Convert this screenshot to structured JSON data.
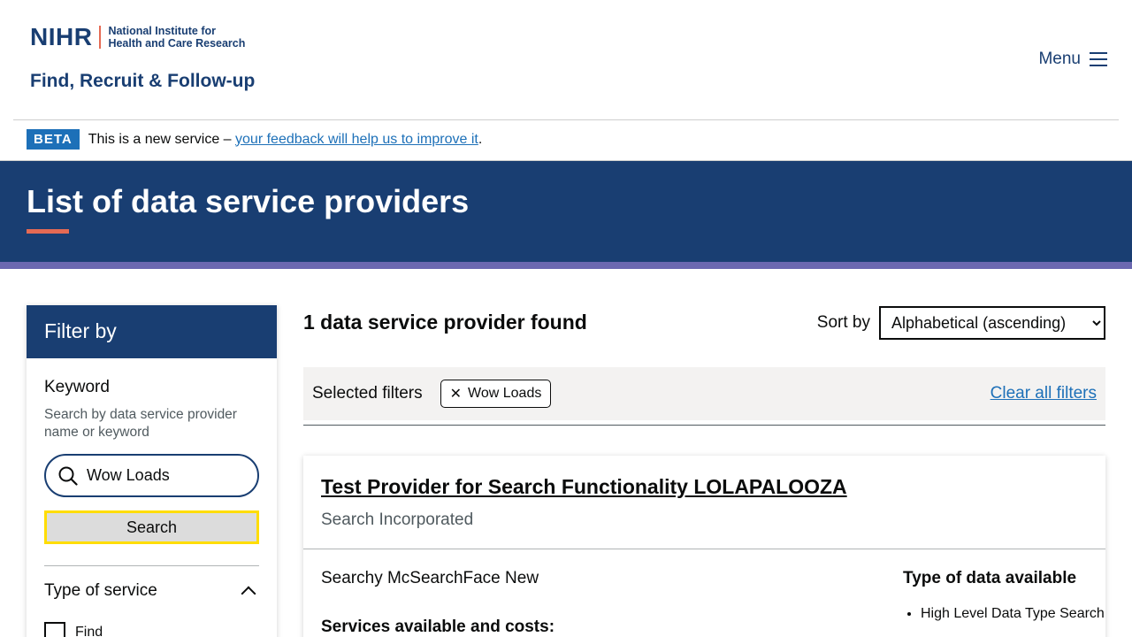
{
  "header": {
    "logo_abbrev": "NIHR",
    "logo_line1": "National Institute for",
    "logo_line2": "Health and Care Research",
    "service_name": "Find, Recruit & Follow-up",
    "menu_label": "Menu"
  },
  "beta": {
    "tag": "BETA",
    "text": "This is a new service –",
    "link": "your feedback will help us to improve it",
    "suffix": "."
  },
  "hero": {
    "title": "List of data service providers"
  },
  "filter": {
    "heading": "Filter by",
    "keyword_label": "Keyword",
    "keyword_hint": "Search by data service provider name or keyword",
    "keyword_value": "Wow Loads",
    "search_button": "Search",
    "type_of_service_label": "Type of service",
    "options": [
      {
        "label": "Find",
        "checked": false
      }
    ]
  },
  "results": {
    "count_text": "1 data service provider found",
    "sort_label": "Sort by",
    "sort_value": "Alphabetical (ascending)",
    "selected_filters_label": "Selected filters",
    "chip": "Wow Loads",
    "clear_all": "Clear all filters"
  },
  "card": {
    "title": "Test Provider for Search Functionality LOLAPALOOZA",
    "organisation": "Search Incorporated",
    "description": "Searchy McSearchFace New",
    "services_heading": "Services available and costs:",
    "data_type_heading": "Type of data available",
    "data_types": [
      "High Level Data Type Search"
    ]
  },
  "colors": {
    "navy": "#193e72",
    "coral": "#e56a54",
    "purple_stripe": "#6b68b0",
    "link_blue": "#1d70b8",
    "focus_yellow": "#ffdd00"
  }
}
